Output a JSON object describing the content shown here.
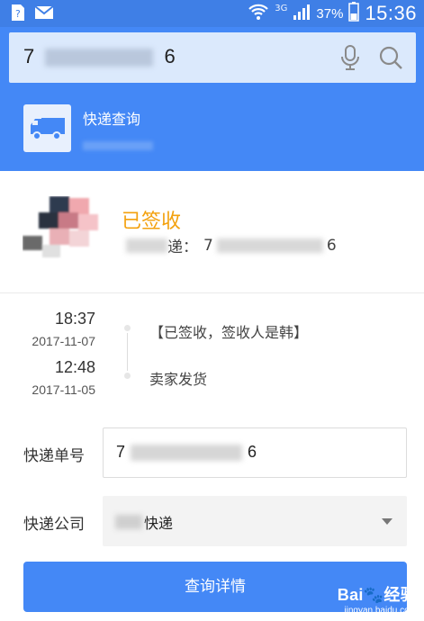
{
  "status_bar": {
    "icons": [
      "sim-icon",
      "mail-icon",
      "wifi-icon",
      "signal-icon",
      "battery-icon"
    ],
    "network": "3G",
    "battery": "37%",
    "time": "15:36"
  },
  "search": {
    "value_start": "7",
    "value_end": "6"
  },
  "header": {
    "title": "快递查询",
    "colors": {
      "header_bg": "#4488f6",
      "accent": "#4488f6",
      "status_signed": "#f3a10e"
    }
  },
  "result": {
    "status": "已签收",
    "number_label_tail": "递：",
    "number_start": "7",
    "number_end": "6"
  },
  "timeline": [
    {
      "time": "18:37",
      "date": "2017-11-07",
      "text": "【已签收，签收人是韩】"
    },
    {
      "time": "12:48",
      "date": "2017-11-05",
      "text": "卖家发货"
    }
  ],
  "form": {
    "tracking_label": "快递单号",
    "tracking_value_start": "7",
    "tracking_value_end": "6",
    "company_label": "快递公司",
    "company_value_tail": "快递",
    "submit_label": "查询详情"
  },
  "watermark": {
    "logo": "Bai🐾经验",
    "url": "jingyan.baidu.com"
  }
}
